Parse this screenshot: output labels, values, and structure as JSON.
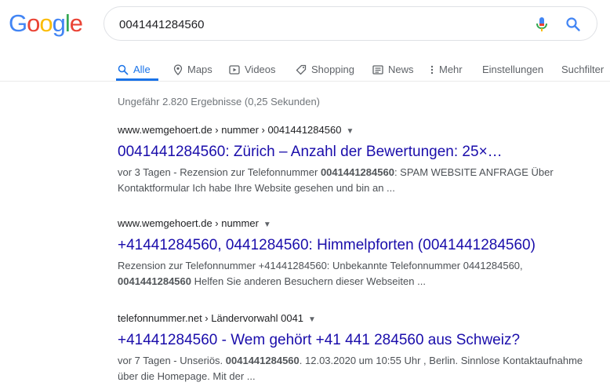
{
  "logo": {
    "text": "Google",
    "letters": [
      "G",
      "o",
      "o",
      "g",
      "l",
      "e"
    ],
    "colors": [
      "#4285f4",
      "#ea4335",
      "#fbbc05",
      "#4285f4",
      "#34a853",
      "#ea4335"
    ]
  },
  "search": {
    "query": "0041441284560"
  },
  "tabs": [
    {
      "label": "Alle",
      "icon": "search-icon",
      "active": true
    },
    {
      "label": "Maps",
      "icon": "map-pin-icon",
      "active": false
    },
    {
      "label": "Videos",
      "icon": "video-icon",
      "active": false
    },
    {
      "label": "Shopping",
      "icon": "tag-icon",
      "active": false
    },
    {
      "label": "News",
      "icon": "newspaper-icon",
      "active": false
    },
    {
      "label": "Mehr",
      "icon": "more-vertical-icon",
      "active": false
    },
    {
      "label": "Einstellungen",
      "active": false
    },
    {
      "label": "Suchfilter",
      "active": false
    }
  ],
  "stats": "Ungefähr 2.820 Ergebnisse (0,25 Sekunden)",
  "results": [
    {
      "cite": "www.wemgehoert.de › nummer › 0041441284560",
      "title": "0041441284560: Zürich – Anzahl der Bewertungen: 25×…",
      "snippet": [
        {
          "t": "vor 3 Tagen - Rezension zur Telefonnummer "
        },
        {
          "t": "0041441284560",
          "b": true
        },
        {
          "t": ": SPAM WEBSITE ANFRAGE Über Kontaktformular Ich habe Ihre Website gesehen und bin an ..."
        }
      ]
    },
    {
      "cite": "www.wemgehoert.de › nummer",
      "title": "+41441284560, 0441284560: Himmelpforten (0041441284560)",
      "snippet": [
        {
          "t": "Rezension zur Telefonnummer +41441284560: Unbekannte Telefonnummer 0441284560, "
        },
        {
          "t": "0041441284560",
          "b": true
        },
        {
          "t": " Helfen Sie anderen Besuchern dieser Webseiten ..."
        }
      ]
    },
    {
      "cite": "telefonnummer.net › Ländervorwahl 0041",
      "title": "+41441284560 - Wem gehört +41 441 284560 aus Schweiz?",
      "snippet": [
        {
          "t": "vor 7 Tagen - Unseriös. "
        },
        {
          "t": "0041441284560",
          "b": true
        },
        {
          "t": ". 12.03.2020 um 10:55 Uhr , Berlin. Sinnlose Kontaktaufnahme über die Homepage. Mit der ..."
        }
      ]
    }
  ]
}
